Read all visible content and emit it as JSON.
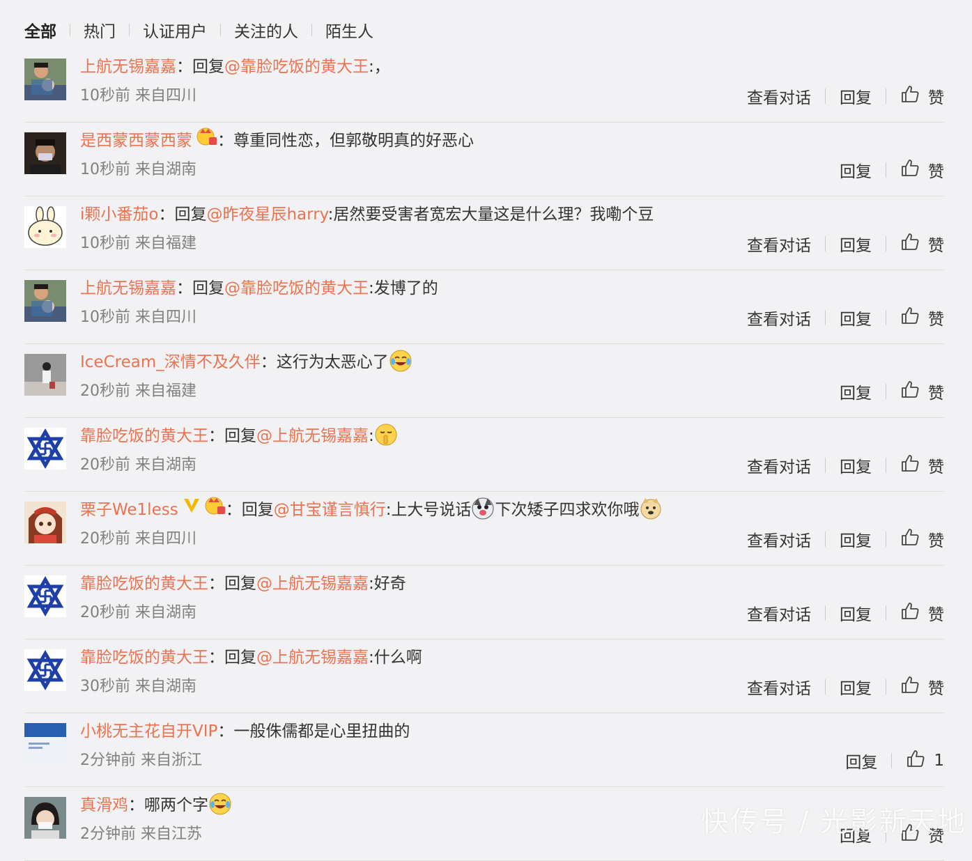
{
  "tabs": [
    "全部",
    "热门",
    "认证用户",
    "关注的人",
    "陌生人"
  ],
  "actions": {
    "view": "查看对话",
    "reply": "回复",
    "like": "赞"
  },
  "colors": {
    "accent": "#eb7350",
    "text": "#333333",
    "meta": "#808080",
    "background": "#f2f2f5"
  },
  "comments": [
    {
      "user": "上航无锡嘉嘉",
      "prefix": "回复",
      "mention": "@靠脸吃饭的黄大王",
      "text": ":，",
      "time": "10秒前 来自四川",
      "avatar": "photo-man-child",
      "view": true,
      "like": "赞"
    },
    {
      "user": "是西蒙西蒙西蒙",
      "prefix": "",
      "mention": "",
      "text": "尊重同性恋，但郭敬明真的好恶心",
      "time": "10秒前 来自湖南",
      "avatar": "photo-masked-man",
      "badge": "crown-icon",
      "view": false,
      "like": "赞"
    },
    {
      "user": "i颗小番茄o",
      "prefix": "回复",
      "mention": "@昨夜星辰harry",
      "text": ":居然要受害者宽宏大量这是什么理？我嘞个豆",
      "time": "10秒前 来自福建",
      "avatar": "bunny-cartoon",
      "view": true,
      "like": "赞"
    },
    {
      "user": "上航无锡嘉嘉",
      "prefix": "回复",
      "mention": "@靠脸吃饭的黄大王",
      "text": ":发博了的",
      "time": "10秒前 来自四川",
      "avatar": "photo-man-child",
      "view": true,
      "like": "赞"
    },
    {
      "user": "IceCream_深情不及久伴",
      "prefix": "",
      "mention": "",
      "text": "这行为太恶心了",
      "time": "20秒前 来自福建",
      "avatar": "photo-street",
      "emoji_after": "laugh-cry-emoji",
      "view": false,
      "like": "赞"
    },
    {
      "user": "靠脸吃饭的黄大王",
      "prefix": "回复",
      "mention": "@上航无锡嘉嘉",
      "text": ":",
      "time": "20秒前 来自湖南",
      "avatar": "star-symbol",
      "emoji_after": "shush-emoji",
      "view": true,
      "like": "赞"
    },
    {
      "user": "栗子We1less",
      "prefix": "回复",
      "mention": "@甘宝谨言慎行",
      "text": ":上大号说话",
      "text2": "下次矮子四求欢你哦",
      "time": "20秒前 来自四川",
      "avatar": "anime-girl",
      "badge": "verified-v-icon",
      "badge2": "crown-icon",
      "emoji_after": "husky-emoji",
      "emoji_after2": "doge-emoji",
      "view": true,
      "like": "赞"
    },
    {
      "user": "靠脸吃饭的黄大王",
      "prefix": "回复",
      "mention": "@上航无锡嘉嘉",
      "text": ":好奇",
      "time": "20秒前 来自湖南",
      "avatar": "star-symbol",
      "view": true,
      "like": "赞"
    },
    {
      "user": "靠脸吃饭的黄大王",
      "prefix": "回复",
      "mention": "@上航无锡嘉嘉",
      "text": ":什么啊",
      "time": "30秒前 来自湖南",
      "avatar": "star-symbol",
      "view": true,
      "like": "赞"
    },
    {
      "user": "小桃无主花自开VIP",
      "prefix": "",
      "mention": "",
      "text": "一般侏儒都是心里扭曲的",
      "time": "2分钟前 来自浙江",
      "avatar": "photo-blue-card",
      "view": false,
      "like": "1"
    },
    {
      "user": "真滑鸡",
      "prefix": "",
      "mention": "",
      "text": "哪两个字",
      "time": "2分钟前 来自江苏",
      "avatar": "photo-child-mask",
      "emoji_after": "laugh-cry-emoji",
      "view": false,
      "like": "赞"
    }
  ],
  "watermark": "快传号 / 光影新天地"
}
